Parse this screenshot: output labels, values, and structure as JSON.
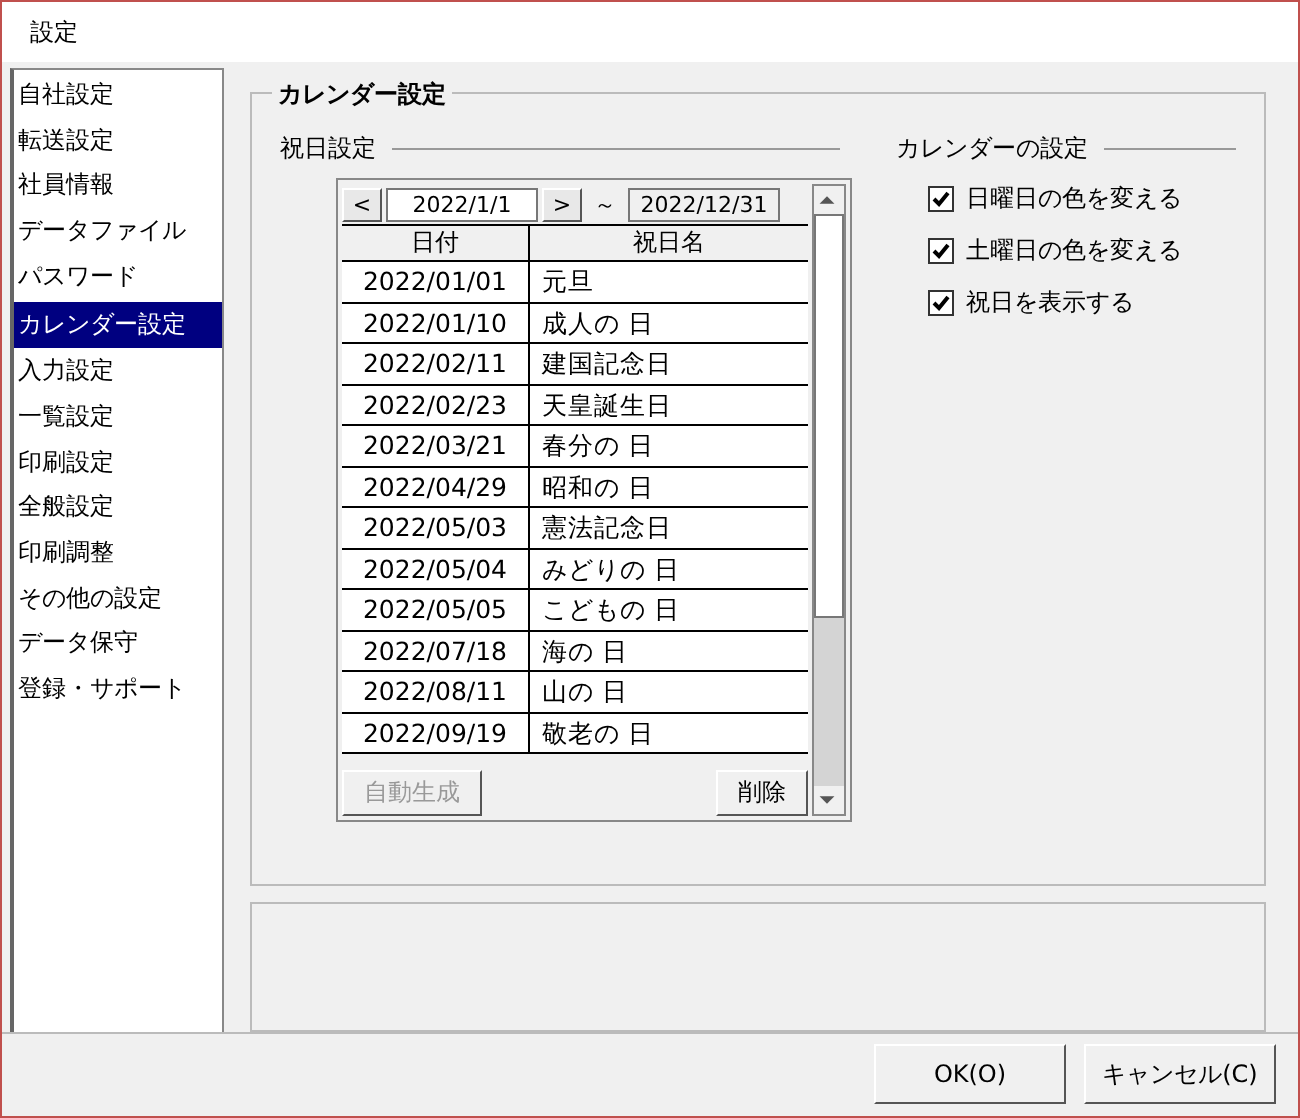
{
  "window": {
    "title": "設定"
  },
  "sidebar": {
    "items": [
      {
        "label": "自社設定",
        "selected": false
      },
      {
        "label": "転送設定",
        "selected": false
      },
      {
        "label": "社員情報",
        "selected": false
      },
      {
        "label": "データファイル",
        "selected": false
      },
      {
        "label": "パスワード",
        "selected": false
      },
      {
        "label": "カレンダー設定",
        "selected": true
      },
      {
        "label": "入力設定",
        "selected": false
      },
      {
        "label": "一覧設定",
        "selected": false
      },
      {
        "label": "印刷設定",
        "selected": false
      },
      {
        "label": "全般設定",
        "selected": false
      },
      {
        "label": "印刷調整",
        "selected": false
      },
      {
        "label": "その他の設定",
        "selected": false
      },
      {
        "label": "データ保守",
        "selected": false
      },
      {
        "label": "登録・サポート",
        "selected": false
      }
    ]
  },
  "group": {
    "title": "カレンダー設定",
    "holidays": {
      "title": "祝日設定",
      "prev": "<",
      "from": "2022/1/1",
      "next": ">",
      "tilde": "～",
      "to": "2022/12/31",
      "columns": [
        "日付",
        "祝日名"
      ],
      "rows": [
        {
          "date": "2022/01/01",
          "name": "元旦"
        },
        {
          "date": "2022/01/10",
          "name": "成人の 日"
        },
        {
          "date": "2022/02/11",
          "name": "建国記念日"
        },
        {
          "date": "2022/02/23",
          "name": "天皇誕生日"
        },
        {
          "date": "2022/03/21",
          "name": "春分の 日"
        },
        {
          "date": "2022/04/29",
          "name": "昭和の 日"
        },
        {
          "date": "2022/05/03",
          "name": "憲法記念日"
        },
        {
          "date": "2022/05/04",
          "name": "みどりの 日"
        },
        {
          "date": "2022/05/05",
          "name": "こどもの 日"
        },
        {
          "date": "2022/07/18",
          "name": "海の 日"
        },
        {
          "date": "2022/08/11",
          "name": "山の 日"
        },
        {
          "date": "2022/09/19",
          "name": "敬老の 日"
        }
      ],
      "buttons": [
        {
          "label": "自動生成",
          "disabled": true
        },
        {
          "label": "削除",
          "disabled": false
        }
      ]
    },
    "calendar": {
      "title": "カレンダーの設定",
      "options": [
        {
          "label": "日曜日の色を変える",
          "checked": true
        },
        {
          "label": "土曜日の色を変える",
          "checked": true
        },
        {
          "label": "祝日を表示する",
          "checked": true
        }
      ]
    }
  },
  "buttons": [
    "OK(O)",
    "キャンセル(C)"
  ]
}
